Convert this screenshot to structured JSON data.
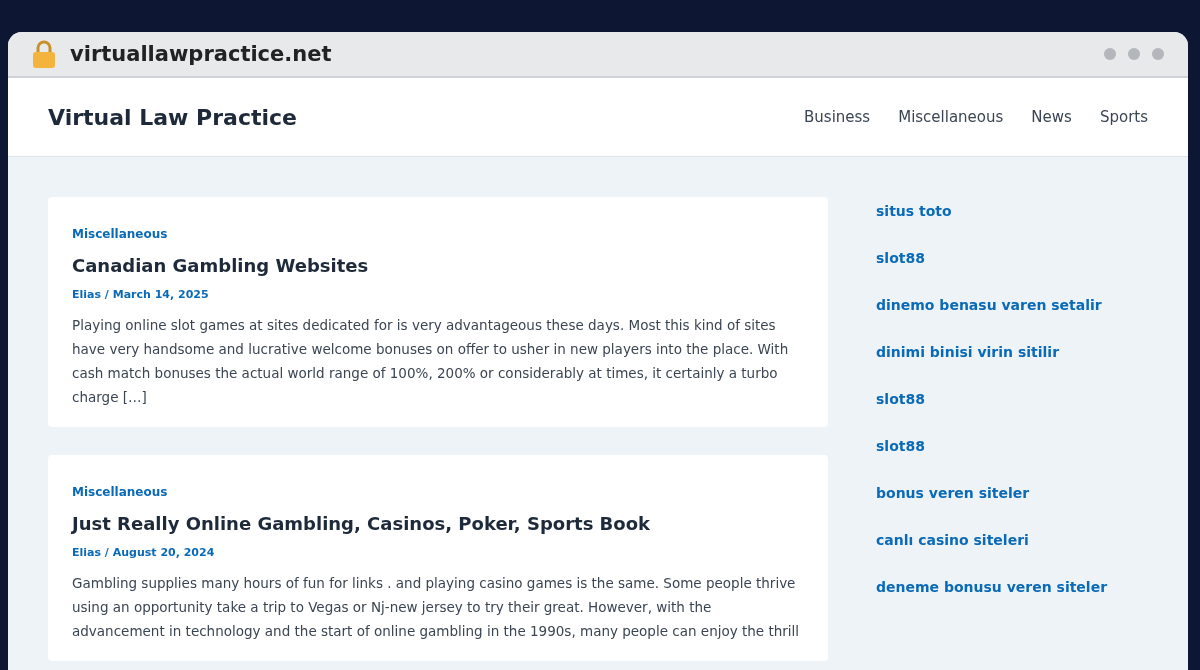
{
  "browser": {
    "url": "virtuallawpractice.net"
  },
  "site": {
    "title": "Virtual Law Practice",
    "nav": [
      {
        "label": "Business"
      },
      {
        "label": "Miscellaneous"
      },
      {
        "label": "News"
      },
      {
        "label": "Sports"
      }
    ]
  },
  "posts": [
    {
      "category": "Miscellaneous",
      "title": "Canadian Gambling Websites",
      "meta": "Elias / March 14, 2025",
      "excerpt": "Playing online slot games at sites dedicated for is very advantageous these days. Most this kind of sites have very handsome and lucrative welcome bonuses on offer to usher in new players into the place. With cash match bonuses the actual world range of 100%, 200% or considerably at times, it certainly a turbo charge […]"
    },
    {
      "category": "Miscellaneous",
      "title": "Just Really Online Gambling, Casinos, Poker, Sports Book",
      "meta": "Elias / August 20, 2024",
      "excerpt": "Gambling supplies many hours of fun for links . and playing casino games is the same. Some people thrive using an opportunity take a trip to Vegas or Nj-new jersey to try their great. However, with the advancement in technology and the start of online gambling in the 1990s, many people can enjoy the thrill"
    }
  ],
  "sidebar": {
    "links": [
      "situs toto",
      "slot88",
      "dinemo benasu varen setalir",
      "dinimi binisi virin sitilir",
      "slot88",
      "slot88",
      "bonus veren siteler",
      "canlı casino siteleri",
      "deneme bonusu veren siteler"
    ]
  }
}
